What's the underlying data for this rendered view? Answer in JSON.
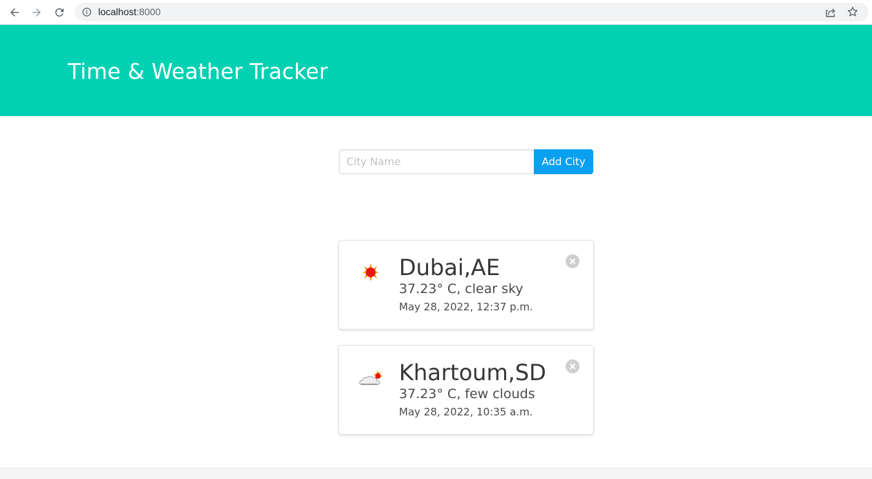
{
  "browser": {
    "url_host": "localhost",
    "url_port": ":8000"
  },
  "hero": {
    "title": "Time & Weather Tracker",
    "background": "#00d1b2"
  },
  "form": {
    "placeholder": "City Name",
    "button_label": "Add City",
    "button_color": "#0aa0f0"
  },
  "cards": [
    {
      "city": "Dubai,AE",
      "weather": "37.23° C, clear sky",
      "time": "May 28, 2022, 12:37 p.m.",
      "icon": "sun-icon"
    },
    {
      "city": "Khartoum,SD",
      "weather": "37.23° C, few clouds",
      "time": "May 28, 2022, 10:35 a.m.",
      "icon": "cloud-sun-icon"
    }
  ]
}
